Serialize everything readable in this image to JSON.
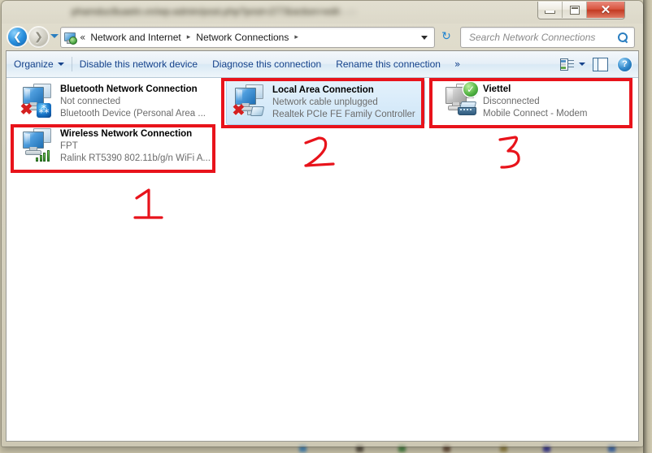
{
  "window": {
    "title_blurred": "phamduc8uaetn.vn/wp-admin/post.php?post=277&action=edit",
    "controls": {
      "minimize": "–",
      "maximize": "□",
      "close": "✕"
    }
  },
  "nav": {
    "back_arrow": "❮",
    "forward_arrow": "❯",
    "breadcrumb_prefix": "«",
    "breadcrumbs": [
      {
        "label": "Network and Internet"
      },
      {
        "label": "Network Connections"
      }
    ],
    "separator": "▸",
    "refresh_glyph": "↻",
    "search_placeholder": "Search Network Connections",
    "search_value": ""
  },
  "toolbar": {
    "organize_label": "Organize",
    "disable_label": "Disable this network device",
    "diagnose_label": "Diagnose this connection",
    "rename_label": "Rename this connection",
    "overflow_label": "»",
    "view_icon_name": "change-your-view",
    "preview_icon_name": "show-preview-pane",
    "help_label": "?"
  },
  "connections": [
    {
      "name": "Bluetooth Network Connection",
      "status": "Not connected",
      "device": "Bluetooth Device (Personal Area ...",
      "icon": "monitor-pair-icon",
      "badge": "bluetooth-icon",
      "disabled_badge": "red-x-icon",
      "selected": false,
      "annotated": false
    },
    {
      "name": "Local Area Connection",
      "status": "Network cable unplugged",
      "device": "Realtek PCIe FE Family Controller",
      "icon": "monitor-pair-icon",
      "badge": "ethernet-plug-icon",
      "disabled_badge": "red-x-icon",
      "selected": true,
      "annotated": true
    },
    {
      "name": "Viettel",
      "status": "Disconnected",
      "device": "Mobile Connect - Modem",
      "icon": "monitor-pair-grey-icon",
      "badge": "modem-icon",
      "disabled_badge": "green-check-icon",
      "selected": false,
      "annotated": true
    },
    {
      "name": "Wireless Network Connection",
      "status": "FPT",
      "device": "Ralink RT5390 802.11b/g/n WiFi A...",
      "icon": "monitor-pair-icon",
      "badge": "signal-bars-icon",
      "disabled_badge": "",
      "selected": false,
      "annotated": true
    }
  ],
  "annotations": {
    "color": "#e8131b",
    "marks": [
      {
        "number": "1",
        "target": "Wireless Network Connection"
      },
      {
        "number": "2",
        "target": "Local Area Connection"
      },
      {
        "number": "3",
        "target": "Viettel"
      }
    ]
  }
}
